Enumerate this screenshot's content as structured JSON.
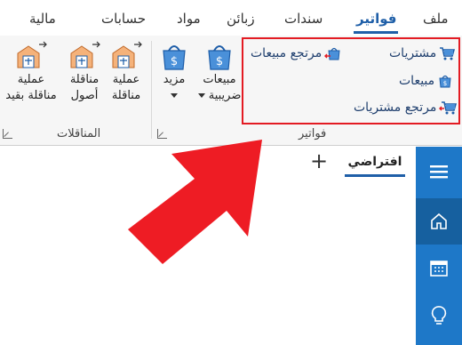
{
  "menu": {
    "file": "ملف",
    "invoices": "فواتير",
    "vouchers": "سندات",
    "customers": "زبائن",
    "items": "مواد",
    "accounts": "حسابات",
    "finance": "مالية"
  },
  "ribbon": {
    "invoices_group": {
      "label": "فواتير",
      "purchases": "مشتريات",
      "sales": "مبيعات",
      "purchase_returns": "مرتجع مشتريات",
      "sales_returns": "مرتجع مبيعات",
      "tax_sales_line1": "مبيعات",
      "tax_sales_line2": "ضريبية",
      "more": "مزيد"
    },
    "transfers_group": {
      "label": "المناقلات",
      "transfer_line1": "عملية",
      "transfer_line2": "مناقلة",
      "asset_transfer_line1": "مناقلة",
      "asset_transfer_line2": "أصول",
      "contract_transfer_line1": "عملية",
      "contract_transfer_line2": "مناقلة بقيد"
    }
  },
  "content": {
    "default_tab": "افتراضي",
    "add_tab": "+"
  },
  "sidebar": {
    "items": [
      "menu-icon",
      "home-icon",
      "calendar-icon",
      "lightbulb-icon"
    ]
  },
  "colors": {
    "accent": "#1f5fa8",
    "sidebar": "#1e78c8",
    "highlight": "#e31b23"
  }
}
